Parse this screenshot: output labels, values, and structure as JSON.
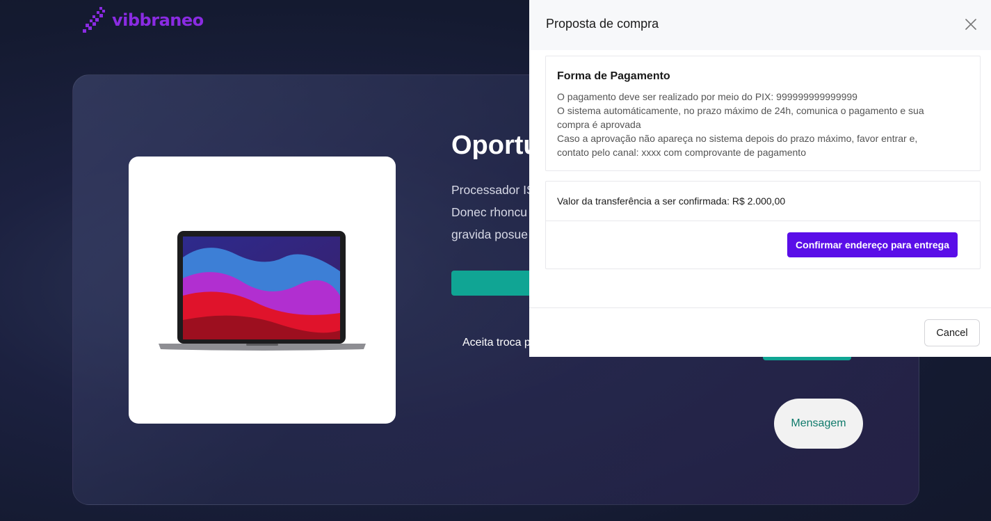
{
  "brand": {
    "name": "vibbraneo",
    "color": "#8a2be2"
  },
  "hero": {
    "title": "Oportu",
    "description_lines": [
      "Processador IS",
      "Donec rhoncu",
      "gravida posue"
    ],
    "trade_text": "Aceita troca p",
    "message_label": "Mensagem",
    "accent_color": "#10a594"
  },
  "modal": {
    "title": "Proposta de compra",
    "payment": {
      "heading": "Forma de Pagamento",
      "lines": [
        "O pagamento deve ser realizado por meio do PIX: 999999999999999",
        "O sistema automáticamente, no prazo máximo de 24h, comunica o pagamento e sua",
        "compra é aprovada",
        "Caso a aprovação não apareça no sistema depois do prazo máximo, favor entrar e,",
        "contato pelo canal: xxxx com comprovante de pagamento"
      ]
    },
    "transfer_text": "Valor da transferência a ser confirmada: R$ 2.000,00",
    "confirm_label": "Confirmar endereço para entrega",
    "cancel_label": "Cancel",
    "primary_color": "#5a0ee8"
  },
  "icons": {
    "close": "close-icon",
    "logo": "logo-icon",
    "product": "laptop-image"
  }
}
